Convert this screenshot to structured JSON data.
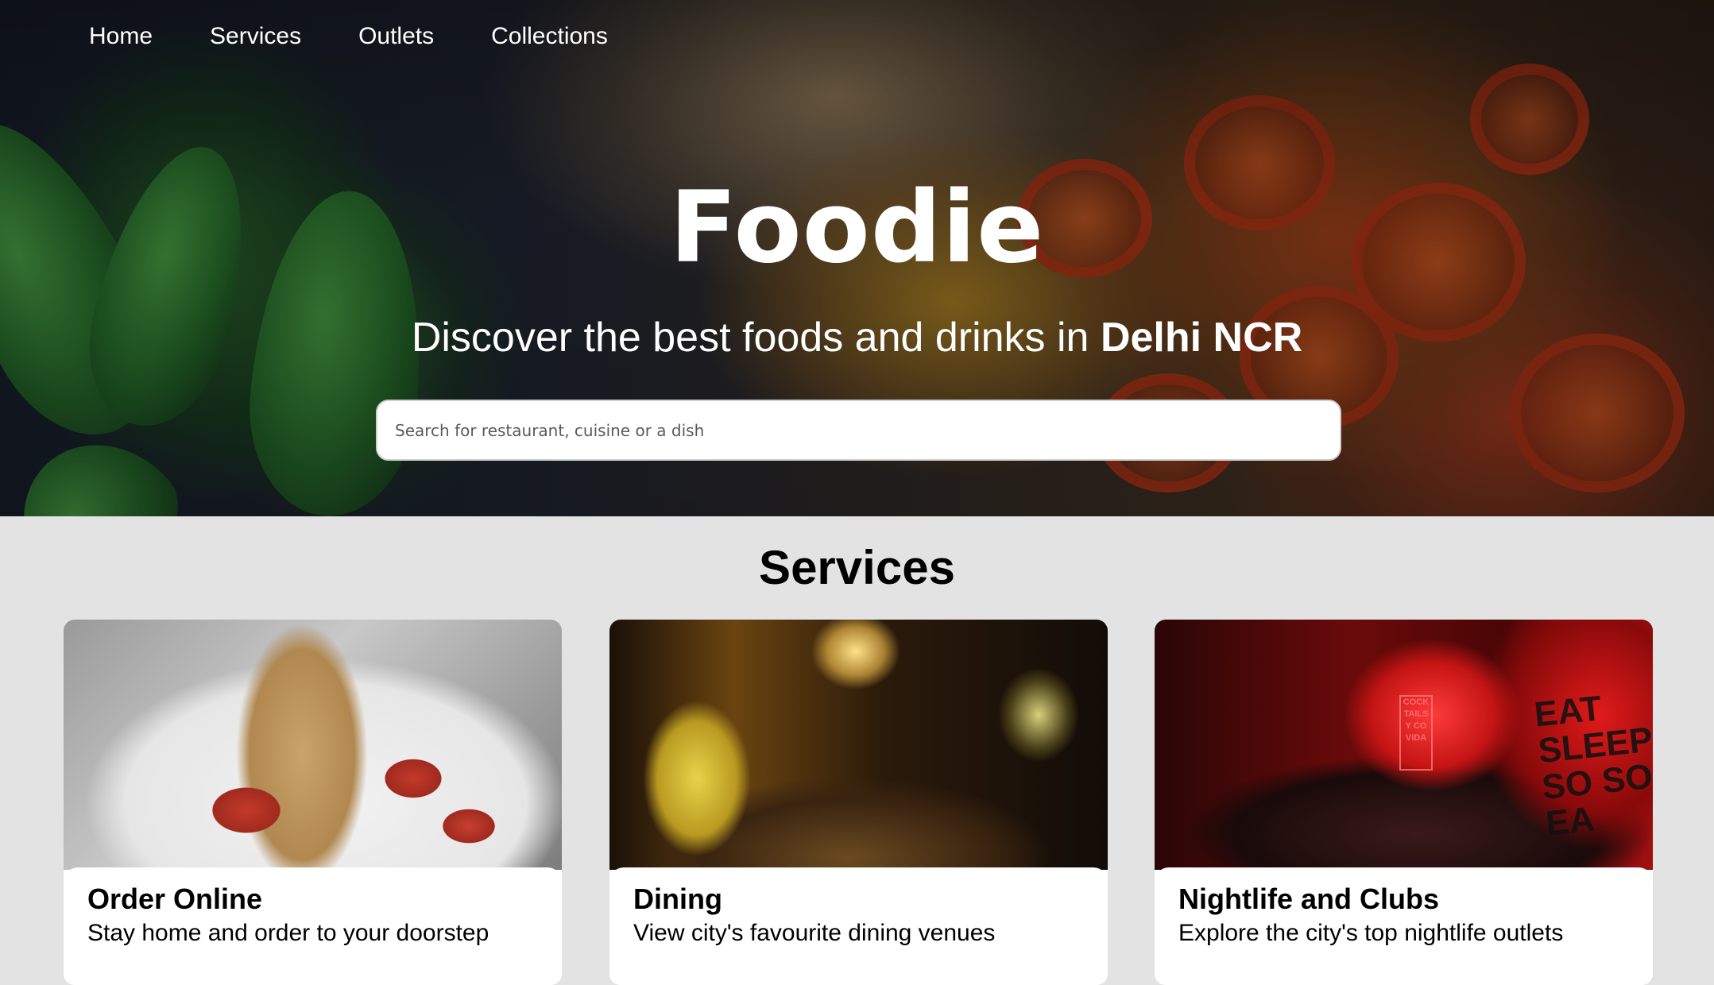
{
  "nav": {
    "items": [
      {
        "label": "Home"
      },
      {
        "label": "Services"
      },
      {
        "label": "Outlets"
      },
      {
        "label": "Collections"
      }
    ]
  },
  "hero": {
    "logo": "Foodie",
    "tagline_prefix": "Discover the best foods and drinks in ",
    "tagline_city": "Delhi NCR",
    "search_placeholder": "Search for restaurant, cuisine or a dish"
  },
  "services": {
    "title": "Services",
    "cards": [
      {
        "title": "Order Online",
        "description": "Stay home and order to your doorstep"
      },
      {
        "title": "Dining",
        "description": "View city's favourite dining venues"
      },
      {
        "title": "Nightlife and Clubs",
        "description": "Explore the city's top nightlife outlets"
      }
    ],
    "neon_sign": "COCK TAILS Y CO VIDA",
    "wall_text": "EAT SLEEP SO SO EA"
  },
  "colors": {
    "background": "#e3e3e3",
    "hero_text": "#ffffff",
    "card_background": "#ffffff"
  }
}
